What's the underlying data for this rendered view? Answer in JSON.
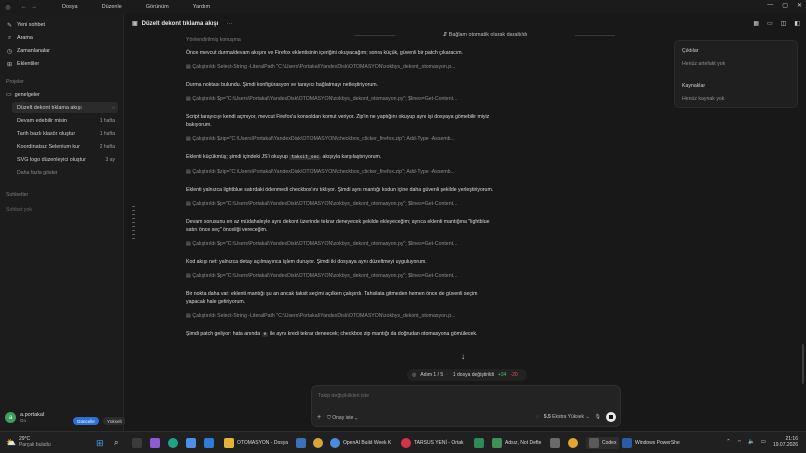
{
  "titlebar": {
    "menus": [
      "Dosya",
      "Düzenle",
      "Görünüm",
      "Yardım"
    ]
  },
  "sidebar": {
    "nav": [
      {
        "label": "Yeni sohbet",
        "icon": "compose-icon"
      },
      {
        "label": "Arama",
        "icon": "search-icon"
      },
      {
        "label": "Zamanlanalar",
        "icon": "clock-icon"
      },
      {
        "label": "Eklentiler",
        "icon": "plugin-icon"
      }
    ],
    "projects_label": "Projeler",
    "project_name": "genelgeler",
    "threads": [
      {
        "title": "Düzelt dekont tıklama akışı",
        "age": ""
      },
      {
        "title": "Devam edebilir misin",
        "age": "1 hafta"
      },
      {
        "title": "Tarih bazlı klasör oluştur",
        "age": "1 hafta"
      },
      {
        "title": "Koordinatsız Selenium kur",
        "age": "2 hafta"
      },
      {
        "title": "SVG logo düzenleyici oluştur",
        "age": "3 ay"
      }
    ],
    "show_more": "Daha fazla göster",
    "chats_label": "Sohbetler",
    "no_chats": "Sohbet yok",
    "user": {
      "initial": "a",
      "name": "a.portakal",
      "plan": "Go",
      "upgrade": "Güncelle",
      "badge": "Yükselt"
    }
  },
  "main": {
    "title": "Düzelt dekont tıklama akışı",
    "compacted": "Bağlam otomatik olarak daraltıldı",
    "section_label": "Yönlendirilmiş konuşma",
    "messages": [
      {
        "kind": "msg",
        "text": "Önce mevcut durma/devam akışını ve Firefox eklentisinin içeriğini okuyacağım; sonra küçük, güvenli bir patch çıkaracım."
      },
      {
        "kind": "cmd",
        "text": "Çalıştırıldı Select-String -LiteralPath \"C:\\Users\\Portakal\\YandexDisk\\OTOMASYON\\zokbys_dekont_otomasyon.p..."
      },
      {
        "kind": "msg",
        "text": "Durma noktası bulundu. Şimdi konfigürasyon ve tarayıcı bağlatmayı netleştiriyorum."
      },
      {
        "kind": "cmd",
        "text": "Çalıştırıldı $p=\"C:\\Users\\Portakal\\YandexDisk\\OTOMASYON\\zokbys_dekont_otomasyon.py\"; $lines=Get-Content..."
      },
      {
        "kind": "msg",
        "text": "Script tarayıcıyı kendi açmıyor, mevcut Firefox'a konsoldan komut veriyor. Zip'in ne yaptığını okuyup aynı işi dosyaya gömebilir miyiz bakıyorum."
      },
      {
        "kind": "cmd",
        "text": "Çalıştırıldı $zip=\"C:\\Users\\Portakal\\YandexDisk\\OTOMASYON\\checkbox_clicker_firefox.zip\"; Add-Type -Assemb..."
      },
      {
        "kind": "msg_code",
        "before": "Eklenti küçükmüş; şimdi içindeki JS'i okuyup ",
        "code": "taksit_sec",
        "after": " akışıyla karşılaştırıyorum."
      },
      {
        "kind": "cmd",
        "text": "Çalıştırıldı $zip=\"C:\\Users\\Portakal\\YandexDisk\\OTOMASYON\\checkbox_clicker_firefox.zip\"; Add-Type -Assemb..."
      },
      {
        "kind": "msg",
        "text": "Eklenti yalnızca lightblue satırdaki ödenmedi checkbox'ını tıklıyor. Şimdi aynı mantığı kodun içine daha güvenli şekilde yerleştiriyorum."
      },
      {
        "kind": "cmd",
        "text": "Çalıştırıldı $p=\"C:\\Users\\Portakal\\YandexDisk\\OTOMASYON\\zokbys_dekont_otomasyon.py\"; $lines=Get-Content..."
      },
      {
        "kind": "msg",
        "text": "Devam sorusunu en az müdahaleyle aynı dekont üzerinde tekrar deneyecek şekilde ekleyeceğim; ayrıca eklenti mantığına \"lightblue satırı önce seç\" önceliği vereceğim."
      },
      {
        "kind": "cmd",
        "text": "Çalıştırıldı $p=\"C:\\Users\\Portakal\\YandexDisk\\OTOMASYON\\zokbys_dekont_otomasyon.py\"; $lines=Get-Content..."
      },
      {
        "kind": "msg",
        "text": "Kod akışı net: yalnızca detay açılmayınca işlem duruyor. Şimdi iki dosyaya aynı düzeltmeyi uyguluyorum."
      },
      {
        "kind": "cmd",
        "text": "Çalıştırıldı $p=\"C:\\Users\\Portakal\\YandexDisk\\OTOMASYON\\zokbys_dekont_otomasyon.py\"; $lines=Get-Content..."
      },
      {
        "kind": "msg",
        "text": "Bir nokta daha var: eklenti mantığı şu an ancak taksit seçimi açılken çalışırdı. Tahsilata gitmeden hemen önce de güvenli seçim yapacak hale getiriyorum."
      },
      {
        "kind": "cmd",
        "text": "Çalıştırıldı Select-String -LiteralPath \"C:\\Users\\Portakal\\YandexDisk\\OTOMASYON\\zokbys_dekont_otomasyon.p..."
      },
      {
        "kind": "msg_code",
        "before": "Şimdi patch geliyor: hata anında ",
        "code": "e",
        "after": " ile aynı kredi tekrar deneecek; checkbox zip mantığı da doğrudan otomasyona gömülecek."
      }
    ]
  },
  "panel": {
    "outputs": "Çıktılar",
    "no_artifacts": "Henüz artefakt yok",
    "sources": "Kaynaklar",
    "no_sources": "Henüz kaynak yok"
  },
  "step": {
    "label": "Adım 1 / 5",
    "files": "1 dosya değiştirildi",
    "added": "+34",
    "removed": "-20"
  },
  "composer": {
    "placeholder": "Takip değişiklikleri iste",
    "approval": "Onay iste",
    "model": "5.5",
    "effort": "Ekstra Yüksek"
  },
  "taskbar": {
    "weather_temp": "29°C",
    "weather_desc": "Parçalı bulutlu",
    "apps": [
      {
        "label": "OTOMASYON - Dosya",
        "color": "#e5b33a"
      },
      {
        "label": "OpenAI Build Week K",
        "color": "#4a8cdb"
      },
      {
        "label": "TARSUS YENİ - Ortak",
        "color": "#d6334a"
      },
      {
        "label": "Adsız, Not Defte",
        "color": "#3f8f57"
      },
      {
        "label": "Codex",
        "color": "#5a5a5a"
      },
      {
        "label": "Windows PowerShe",
        "color": "#2a5aa8"
      }
    ],
    "time": "21:16",
    "date": "19.07.2026"
  }
}
